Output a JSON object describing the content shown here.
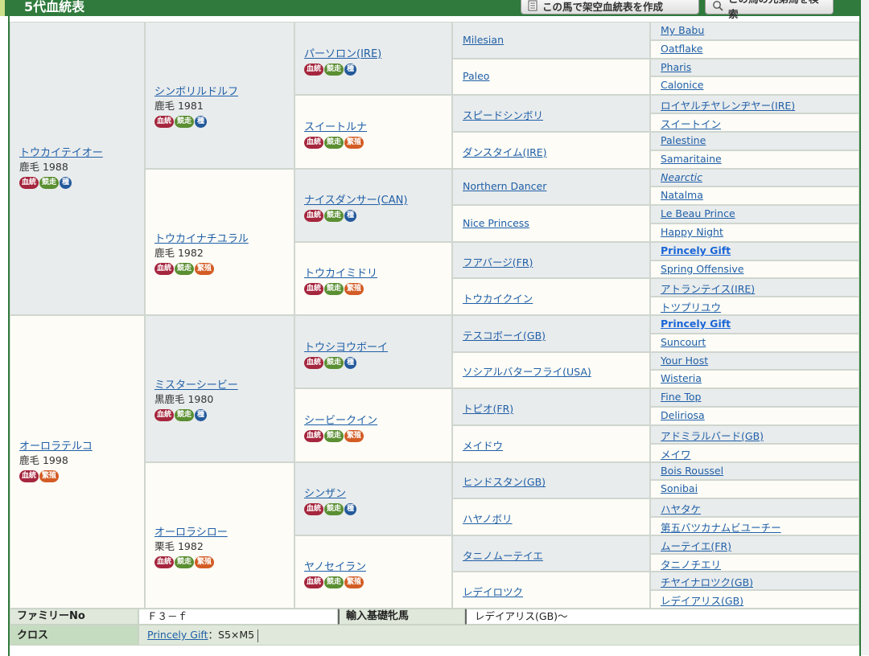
{
  "header": {
    "title": "5代血統表",
    "btn_make": "この馬で架空血統表を作成",
    "btn_search": "この馬の兄弟馬を検索"
  },
  "badges": {
    "blood": "血統",
    "race": "競走",
    "stud": "種",
    "brood": "繁殖"
  },
  "g1": [
    {
      "name": "トウカイテイオー",
      "info": "鹿毛 1988",
      "badges": [
        "blood",
        "race",
        "stud"
      ]
    },
    {
      "name": "オーロラテルコ",
      "info": "鹿毛 1998",
      "badges": [
        "blood",
        "brood"
      ]
    }
  ],
  "g2": [
    {
      "name": "シンボリルドルフ",
      "info": "鹿毛 1981",
      "badges": [
        "blood",
        "race",
        "stud"
      ]
    },
    {
      "name": "トウカイナチユラル",
      "info": "鹿毛 1982",
      "badges": [
        "blood",
        "race",
        "brood"
      ]
    },
    {
      "name": "ミスターシービー",
      "info": "黒鹿毛 1980",
      "badges": [
        "blood",
        "race",
        "stud"
      ]
    },
    {
      "name": "オーロラシロー",
      "info": "栗毛 1982",
      "badges": [
        "blood",
        "race",
        "brood"
      ]
    }
  ],
  "g3": [
    {
      "name": "パーソロン(IRE)",
      "badges": [
        "blood",
        "race",
        "stud"
      ]
    },
    {
      "name": "スイートルナ",
      "badges": [
        "blood",
        "race",
        "brood"
      ]
    },
    {
      "name": "ナイスダンサー(CAN)",
      "badges": [
        "blood",
        "race",
        "stud"
      ]
    },
    {
      "name": "トウカイミドリ",
      "badges": [
        "blood",
        "race",
        "brood"
      ]
    },
    {
      "name": "トウシヨウボーイ",
      "badges": [
        "blood",
        "race",
        "stud"
      ]
    },
    {
      "name": "シービークイン",
      "badges": [
        "blood",
        "race",
        "brood"
      ]
    },
    {
      "name": "シンザン",
      "badges": [
        "blood",
        "race",
        "stud"
      ]
    },
    {
      "name": "ヤノセイラン",
      "badges": [
        "blood",
        "race",
        "brood"
      ]
    }
  ],
  "g4": [
    "Milesian",
    "Paleo",
    "スピードシンボリ",
    "ダンスタイム(IRE)",
    "Northern Dancer",
    "Nice Princess",
    "フアバージ(FR)",
    "トウカイクイン",
    "テスコボーイ(GB)",
    "ソシアルバターフライ(USA)",
    "トピオ(FR)",
    "メイドウ",
    "ヒンドスタン(GB)",
    "ハヤノボリ",
    "タニノムーテイエ",
    "レデイロツク"
  ],
  "g5": [
    "My Babu",
    "Oatflake",
    "Pharis",
    "Calonice",
    "ロイヤルチヤレンヂヤー(IRE)",
    "スイートイン",
    "Palestine",
    "Samaritaine",
    "Nearctic",
    "Natalma",
    "Le Beau Prince",
    "Happy Night",
    "Princely Gift",
    "Spring Offensive",
    "アトランテイス(IRE)",
    "トツプリユウ",
    "Princely Gift",
    "Suncourt",
    "Your Host",
    "Wisteria",
    "Fine Top",
    "Deliriosa",
    "アドミラルバード(GB)",
    "メイワ",
    "Bois Roussel",
    "Sonibai",
    "ハヤタケ",
    "第五バツカナムビユーチー",
    "ムーテイエ(FR)",
    "タニノチエリ",
    "チヤイナロツク(GB)",
    "レデイアリス(GB)"
  ],
  "footer": {
    "family_label": "ファミリーNo",
    "family_value": "Ｆ３－ｆ",
    "import_label": "輸入基礎牝馬",
    "import_value": "レデイアリス(GB)～",
    "cross_label": "クロス",
    "cross_horse": "Princely Gift",
    "cross_value": "：S5×M5"
  }
}
